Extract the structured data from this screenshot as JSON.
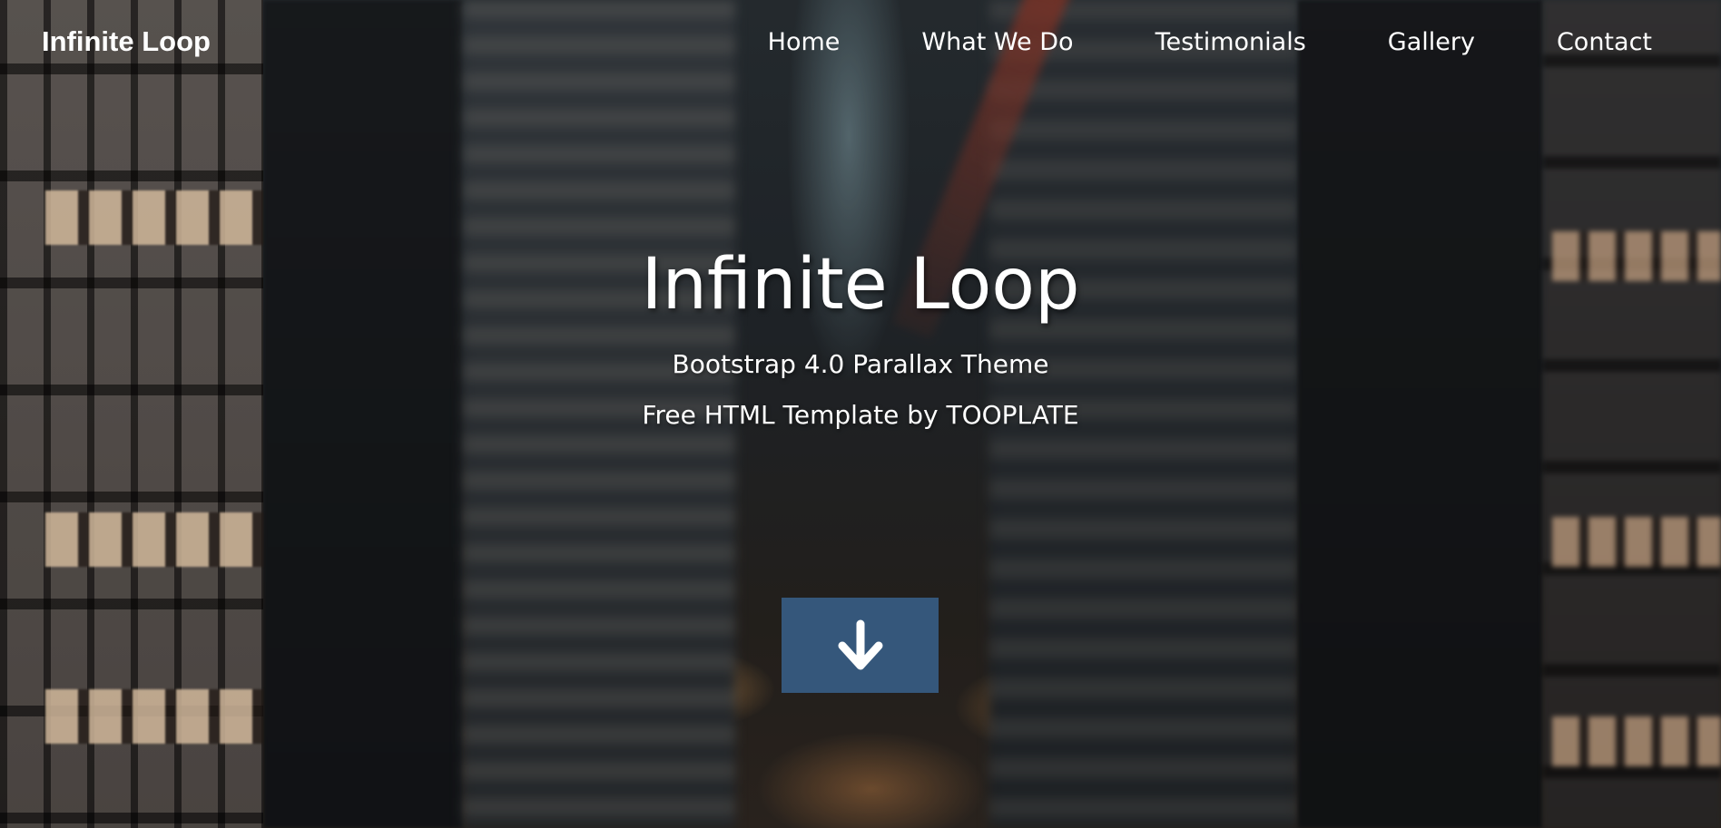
{
  "nav": {
    "brand": "Infinite Loop",
    "items": [
      {
        "label": "Home"
      },
      {
        "label": "What We Do"
      },
      {
        "label": "Testimonials"
      },
      {
        "label": "Gallery"
      },
      {
        "label": "Contact"
      }
    ]
  },
  "hero": {
    "title": "Infinite Loop",
    "subtitle": "Bootstrap 4.0 Parallax Theme",
    "tagline": "Free HTML Template by TOOPLATE",
    "scroll_button": {
      "icon": "arrow-down-icon",
      "color": "#35577b"
    }
  }
}
